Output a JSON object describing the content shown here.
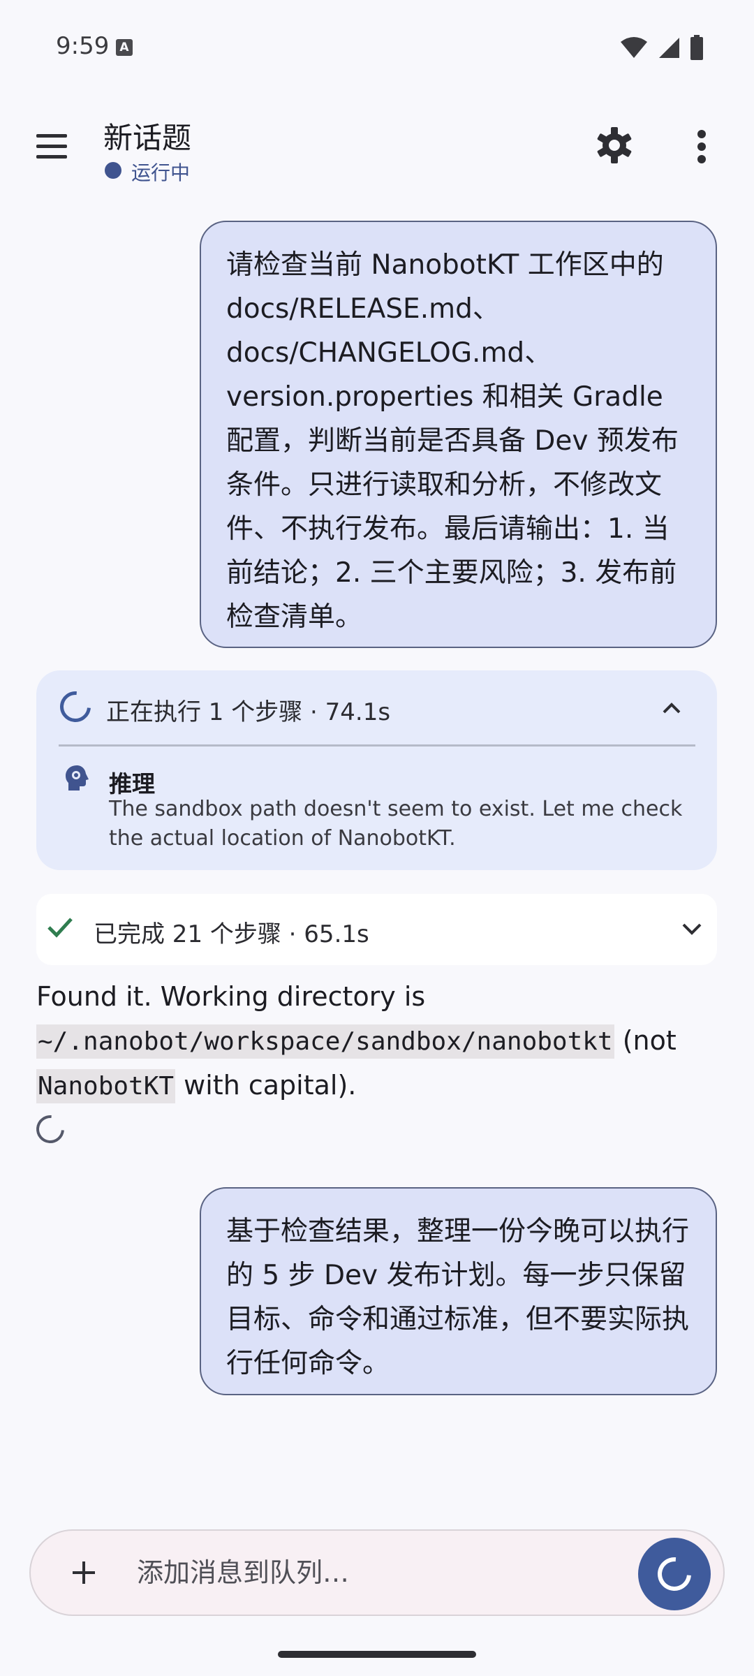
{
  "status_bar": {
    "time": "9:59",
    "notification_icon_letter": "A",
    "icons": [
      "wifi-icon",
      "signal-icon",
      "battery-icon"
    ]
  },
  "app_bar": {
    "title": "新话题",
    "status": "运行中",
    "status_color": "#40548f",
    "actions": [
      "gear-icon",
      "more-vert-icon"
    ]
  },
  "messages": {
    "user_1": "请检查当前 NanobotKT 工作区中的 docs/RELEASE.md、docs/CHANGELOG.md、version.properties 和相关 Gradle 配置，判断当前是否具备 Dev 预发布条件。只进行读取和分析，不修改文件、不执行发布。最后请输出：1. 当前结论；2. 三个主要风险；3. 发布前检查清单。",
    "running": {
      "title": "正在执行 1 个步骤 · 74.1s",
      "reason_title": "推理",
      "reason_text": "The sandbox path doesn't seem to exist. Let me check the actual location of NanobotKT."
    },
    "done": {
      "title": "已完成 21 个步骤 · 65.1s"
    },
    "assistant": {
      "prefix": "Found it. Working directory is ",
      "code_path": "~/.nanobot/workspace/sandbox/nanobotkt",
      "middle": " (not ",
      "code_name": "NanobotKT",
      "suffix": " with capital)."
    },
    "user_2": "基于检查结果，整理一份今晚可以执行的 5 步 Dev 发布计划。每一步只保留目标、命令和通过标准，但不要实际执行任何命令。"
  },
  "composer": {
    "placeholder": "添加消息到队列…",
    "accent": "#3f5b9c"
  }
}
